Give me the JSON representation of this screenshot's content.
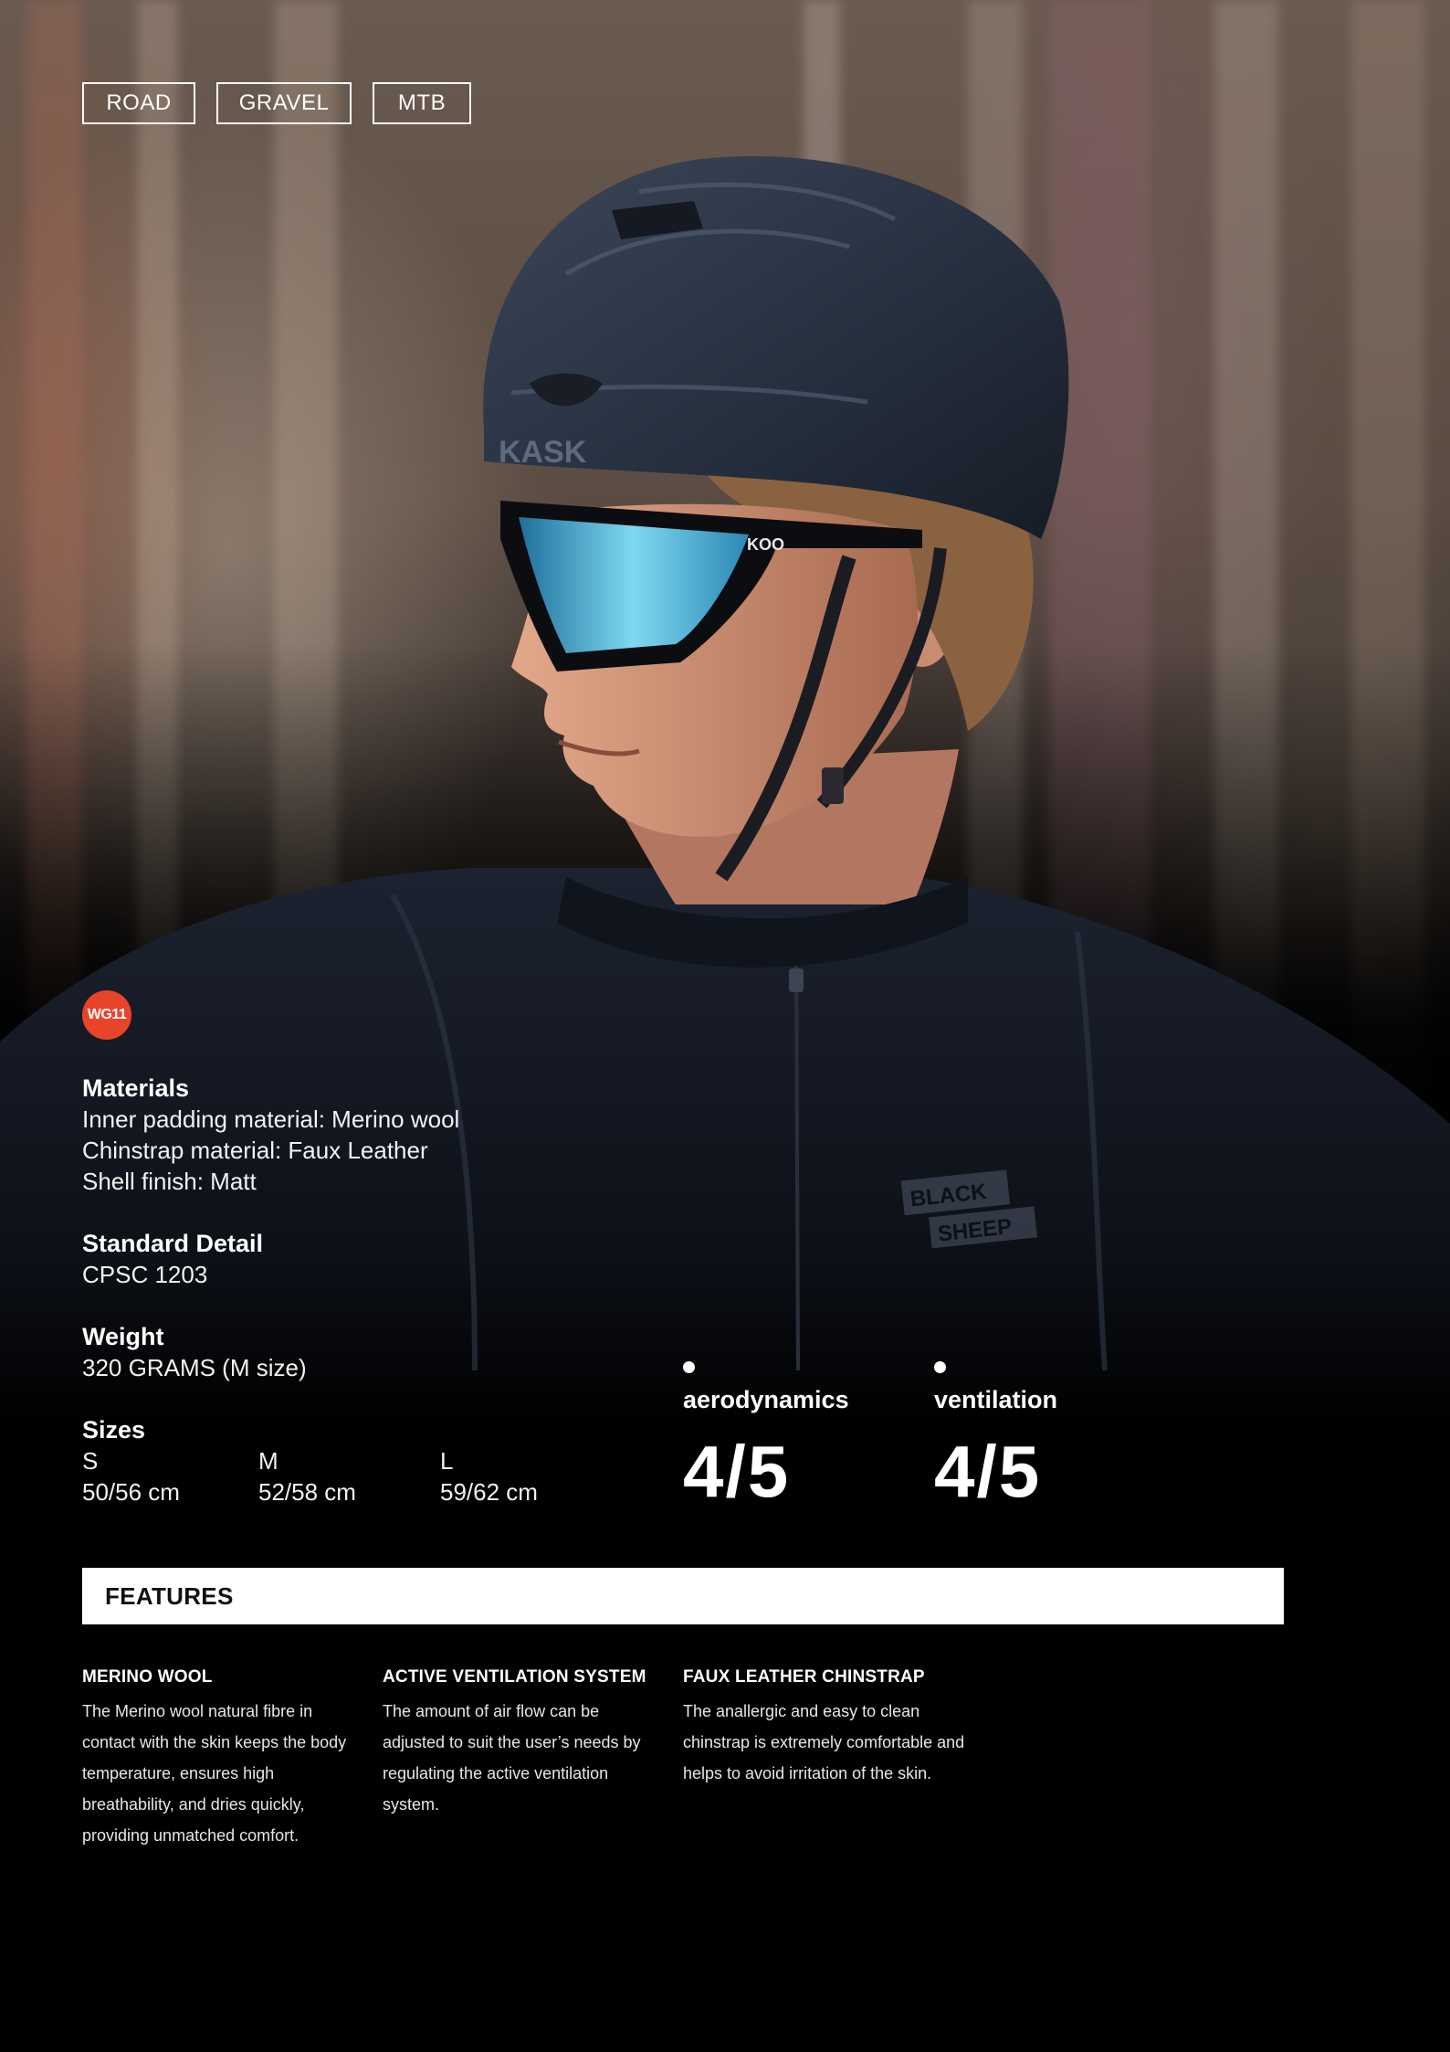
{
  "categories": [
    "ROAD",
    "GRAVEL",
    "MTB"
  ],
  "badge": "WG11",
  "hero": {
    "helmet_logo": "KASK",
    "glasses_logo": "KOO",
    "jersey_text_1": "BLACK",
    "jersey_text_2": "SHEEP"
  },
  "specs": {
    "materials": {
      "title": "Materials",
      "lines": [
        "Inner padding material: Merino wool",
        "Chinstrap material: Faux Leather",
        "Shell finish: Matt"
      ]
    },
    "standard": {
      "title": "Standard Detail",
      "value": "CPSC 1203"
    },
    "weight": {
      "title": "Weight",
      "value": "320 GRAMS (M size)"
    },
    "sizes": {
      "title": "Sizes",
      "items": [
        {
          "size": "S",
          "range": "50/56 cm"
        },
        {
          "size": "M",
          "range": "52/58 cm"
        },
        {
          "size": "L",
          "range": "59/62 cm"
        }
      ]
    }
  },
  "ratings": [
    {
      "label": "aerodynamics",
      "score": "4/5",
      "value": 4,
      "max": 5
    },
    {
      "label": "ventilation",
      "score": "4/5",
      "value": 4,
      "max": 5
    }
  ],
  "features": {
    "heading": "FEATURES",
    "items": [
      {
        "title": "MERINO WOOL",
        "text": "The Merino wool natural fibre in contact with the skin keeps the body temperature, ensures high breathability, and dries quickly, providing unmatched comfort."
      },
      {
        "title": "ACTIVE VENTILATION SYSTEM",
        "text": "The amount of air flow can be adjusted to suit the user’s needs by regulating the active ventilation system."
      },
      {
        "title": "FAUX LEATHER CHINSTRAP",
        "text": "The anallergic and easy to clean chinstrap is extremely comfortable and helps to avoid irritation of the skin."
      }
    ]
  },
  "colors": {
    "background": "#000000",
    "badge": "#e8442a",
    "helmet": "#2b3445",
    "lens": "#4fc3e6"
  }
}
